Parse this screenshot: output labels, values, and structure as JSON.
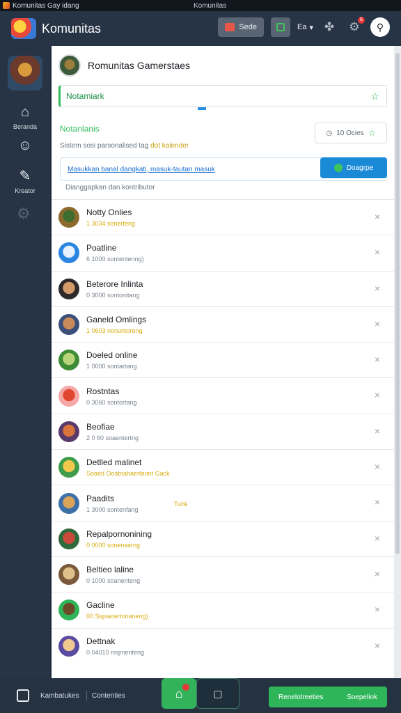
{
  "titlebar": {
    "title": "Komunitas Gay idang",
    "center": "Komunitas"
  },
  "header": {
    "app_name": "Komunitas",
    "gift_label": "Sede",
    "dropdown_label": "Ea",
    "settings_badge": "6"
  },
  "sidebar": {
    "items": [
      {
        "label": "Beranda",
        "icon": "home-icon"
      },
      {
        "label": "",
        "icon": "smile-icon"
      },
      {
        "label": "Kreator",
        "icon": "feather-icon"
      }
    ]
  },
  "community": {
    "title": "Romunitas Gamerstaes"
  },
  "search": {
    "value": "Notamiark"
  },
  "section": {
    "title": "Notanlanis",
    "sort_label": "10 Ocies",
    "description": "Sistem sosi parsonalised tag",
    "description_highlight": "dot kalender",
    "info_link": "Masukkan banal dangkati, masuk-tautan masuk",
    "action_label": "Doagrpe",
    "meta": "Dianggapkan dan kontributor"
  },
  "members": [
    {
      "name": "Notty Onlies",
      "status": "1 3034 sonerteng",
      "status_color": "yellow",
      "avatar": [
        "#8c6a2e",
        "#3f6d2f"
      ]
    },
    {
      "name": "Poatline",
      "status": "6 1000 sontentenng)",
      "status_color": "gray",
      "avatar": [
        "#2a86e0",
        "#e6f3ff"
      ]
    },
    {
      "name": "Beterore Inlinta",
      "status": "0 3000 sontonitang",
      "status_color": "gray",
      "avatar": [
        "#2f2a2a",
        "#d49a6a"
      ]
    },
    {
      "name": "Ganeld Omlings",
      "status": "1 0603 nonuntoreng",
      "status_color": "yellow",
      "avatar": [
        "#3a4f7a",
        "#c98a5a"
      ]
    },
    {
      "name": "Doeled online",
      "status": "1 0000 sontartang",
      "status_color": "gray",
      "avatar": [
        "#3e8c36",
        "#b9d47a"
      ]
    },
    {
      "name": "Rostntas",
      "status": "0 3060 sontortang",
      "status_color": "gray",
      "avatar": [
        "#f4a8a8",
        "#e0472e"
      ]
    },
    {
      "name": "Beofiae",
      "status": "2 0 60 soaentertng",
      "status_color": "gray",
      "avatar": [
        "#5a3a6a",
        "#d9743a"
      ]
    },
    {
      "name": "Detlled malinet",
      "status": "Soaed Ooatnahaertaont Gack",
      "status_color": "yellow",
      "avatar": [
        "#3e9c4a",
        "#f2c94c"
      ]
    },
    {
      "name": "Paadits",
      "status": "1 3000 sontenfang",
      "status_color": "gray",
      "avatar": [
        "#3d6fa8",
        "#d9a35a"
      ],
      "tag": "Tuhk"
    },
    {
      "name": "Repalpornonining",
      "status": "0 0000 sonenserng",
      "status_color": "yellow",
      "avatar": [
        "#2f6b3a",
        "#c94a3a"
      ]
    },
    {
      "name": "Beltieo laline",
      "status": "0 1000 soanenteng",
      "status_color": "gray",
      "avatar": [
        "#7a5a3a",
        "#e0c08a"
      ]
    },
    {
      "name": "Gacline",
      "status": "00 Sspiaoertonaneng)",
      "status_color": "yellow",
      "avatar": [
        "#2fb559",
        "#6b4a2a"
      ]
    },
    {
      "name": "Dettnak",
      "status": "0 04010 reqmenteng",
      "status_color": "gray",
      "avatar": [
        "#5a4aa0",
        "#f0c890"
      ]
    }
  ],
  "bottom": {
    "label1": "Kambatukes",
    "label2": "Contenties",
    "green_left": "Renelotreeties",
    "green_right": "Soepeliok"
  }
}
